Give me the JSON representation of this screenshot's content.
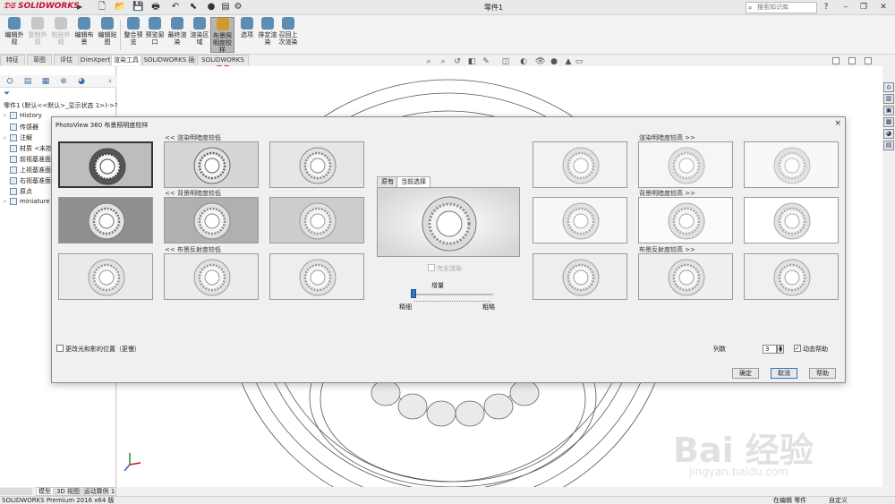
{
  "app": {
    "title": "零件1",
    "brand": "SOLIDWORKS",
    "search_placeholder": "搜索知识库",
    "help_label": "?"
  },
  "command_manager": {
    "buttons": [
      {
        "label": "编辑外观",
        "state": "normal"
      },
      {
        "label": "复制外观",
        "state": "disabled"
      },
      {
        "label": "粘贴外观",
        "state": "disabled"
      },
      {
        "label": "编辑布景",
        "state": "normal"
      },
      {
        "label": "编辑贴图",
        "state": "normal"
      },
      {
        "label": "整合预览",
        "state": "normal"
      },
      {
        "label": "预览窗口",
        "state": "normal"
      },
      {
        "label": "最终渲染",
        "state": "normal"
      },
      {
        "label": "渲染区域",
        "state": "normal"
      },
      {
        "label": "布景照明度校样",
        "state": "active"
      },
      {
        "label": "选项",
        "state": "normal"
      },
      {
        "label": "排定渲染",
        "state": "normal"
      },
      {
        "label": "召回上次渲染",
        "state": "normal"
      }
    ],
    "tabs": [
      "特征",
      "草图",
      "评估",
      "DimXpert",
      "渲染工具",
      "SOLIDWORKS 插件",
      "SOLIDWORKS MBD"
    ],
    "active_tab": "渲染工具"
  },
  "feature_tree": {
    "root": "零件1 (默认<<默认>_显示状态 1>)->?",
    "items": [
      {
        "label": "History",
        "expandable": true
      },
      {
        "label": "传感器",
        "expandable": false
      },
      {
        "label": "注解",
        "expandable": true
      },
      {
        "label": "材质 <未指定>",
        "expandable": false
      },
      {
        "label": "前视基准面",
        "expandable": false
      },
      {
        "label": "上视基准面",
        "expandable": false
      },
      {
        "label": "右视基准面",
        "expandable": false
      },
      {
        "label": "原点",
        "expandable": false
      },
      {
        "label": "miniature",
        "expandable": true
      }
    ]
  },
  "dialog": {
    "title": "PhotoView 360 布景照明度校样",
    "close_icon": "×",
    "groups": {
      "render_dark": "<< 渲染明暗度较低",
      "bg_dark": "<< 背景明暗度较低",
      "reflect_dark": "<< 布景反射度较低",
      "render_bright": "渲染明暗度较高 >>",
      "bg_bright": "背景明暗度较高 >>",
      "reflect_bright": "布景反射度较高 >>"
    },
    "preview_tabs": [
      "原有",
      "当前选择"
    ],
    "active_preview_tab": "当前选择",
    "full_render_label": "完全渲染",
    "full_render_checked": false,
    "gain_label": "增量",
    "gain_min_label": "精细",
    "gain_max_label": "粗略",
    "gain_value": 0.05,
    "change_light_label": "更改光和影的位置（更慢）",
    "change_light_checked": false,
    "columns_label": "列数",
    "columns_value": "3",
    "dynamic_help_label": "动态帮助",
    "dynamic_help_checked": true,
    "buttons": {
      "ok": "确定",
      "cancel": "取消",
      "help": "帮助"
    }
  },
  "model_tabs": [
    "模型",
    "3D 视图",
    "运动算例 1"
  ],
  "active_model_tab": "模型",
  "status": {
    "left": "SOLIDWORKS Premium 2016 x64 版",
    "editing": "在编辑 零件",
    "custom": "自定义"
  },
  "watermark": {
    "brand": "Bai 经验",
    "url": "jingyan.baidu.com"
  },
  "colors": {
    "accent_red": "#c8102e",
    "select_blue": "#2b78c5"
  }
}
